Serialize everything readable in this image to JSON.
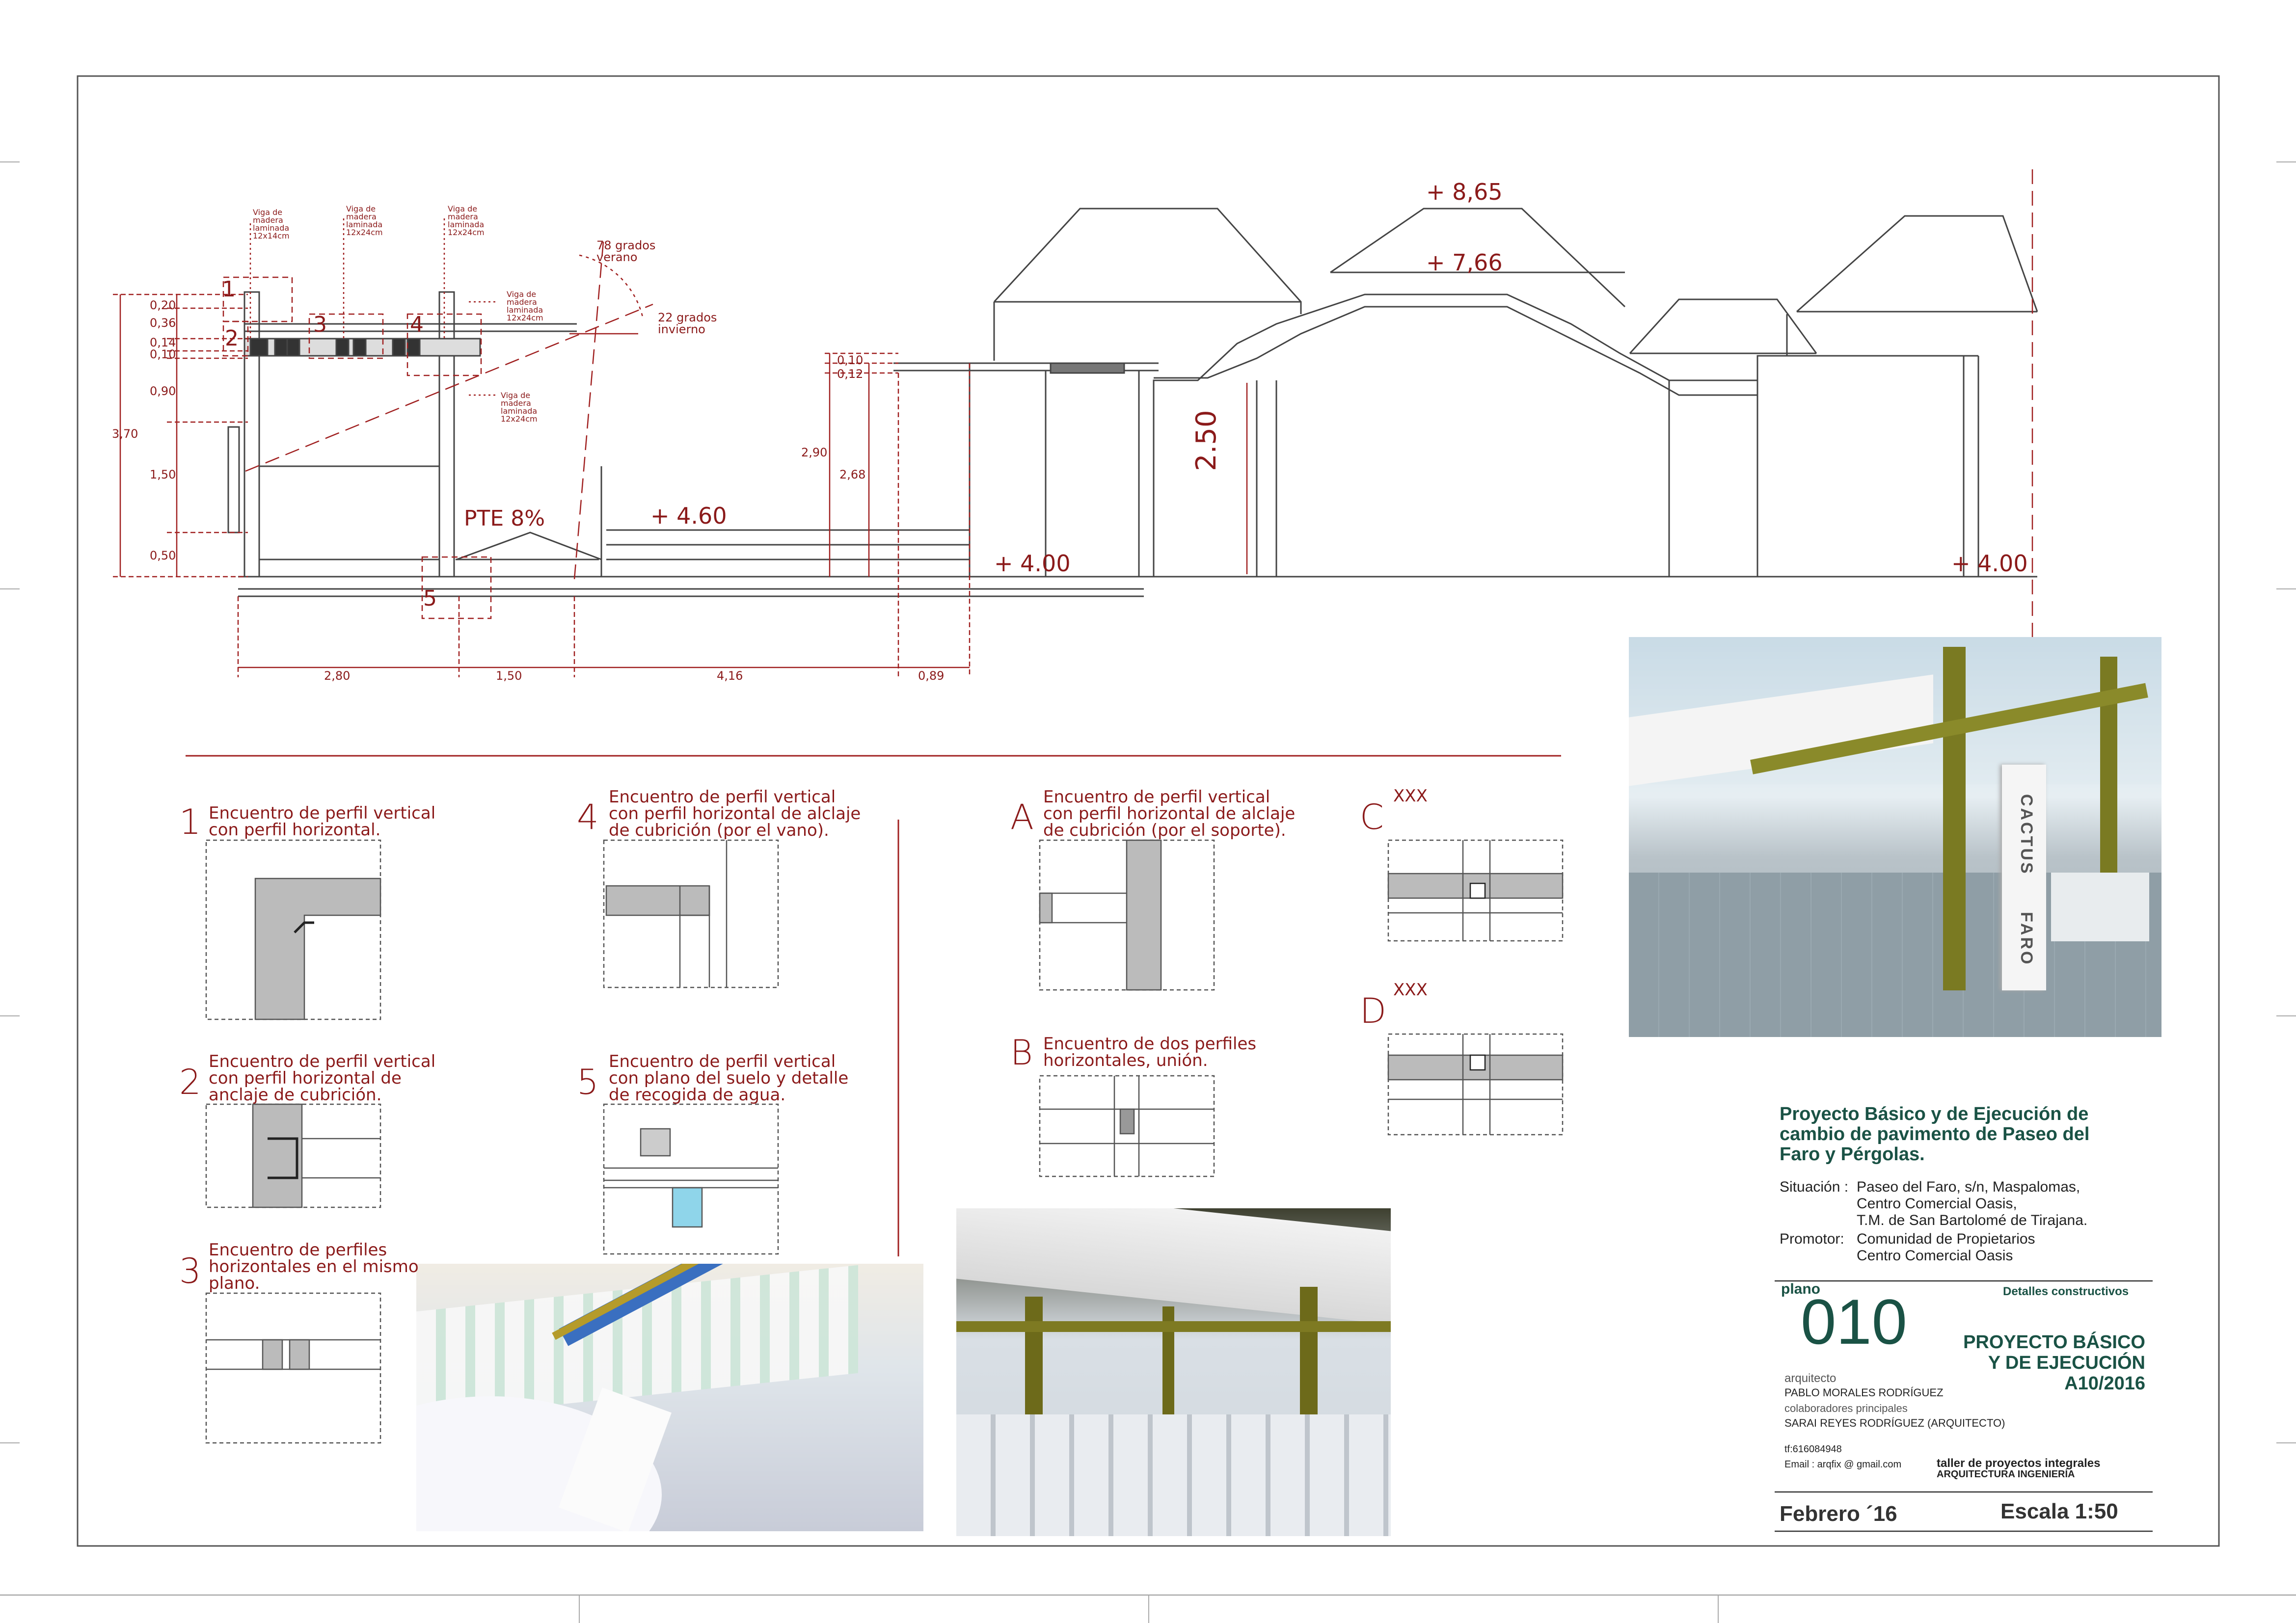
{
  "section": {
    "levels": [
      "+ 8,65",
      "+ 7,66",
      "+ 4.60",
      "+ 4.00",
      "+ 4.00"
    ],
    "slope": "PTE 8%",
    "height_label": "2.50",
    "sun_summer": [
      "78 grados",
      "verano"
    ],
    "sun_winter": [
      "22 grados",
      "invierno"
    ],
    "vertical_dims_left": [
      "0,20",
      "0,36",
      "0,14",
      "0,10",
      "0,90",
      "1,50",
      "0,50"
    ],
    "total_height": "3,70",
    "vertical_dims_right": [
      "0,10",
      "0,12",
      "2,90",
      "2,68"
    ],
    "horizontal_dims": [
      "2,80",
      "1,50",
      "4,16",
      "0,89"
    ],
    "beam_notes": [
      [
        "Viga de",
        "madera",
        "laminada",
        "12x14cm"
      ],
      [
        "Viga de",
        "madera",
        "laminada",
        "12x24cm"
      ],
      [
        "Viga de",
        "madera",
        "laminada",
        "12x24cm"
      ],
      [
        "Viga de",
        "madera",
        "laminada",
        "12x24cm"
      ],
      [
        "Viga de",
        "madera",
        "laminada",
        "12x24cm"
      ]
    ],
    "callouts": [
      "1",
      "2",
      "3",
      "4",
      "5"
    ]
  },
  "details": [
    {
      "id": "1",
      "lines": [
        "Encuentro de perfil vertical",
        "con perfil horizontal."
      ]
    },
    {
      "id": "2",
      "lines": [
        "Encuentro de perfil vertical",
        "con perfil horizontal de",
        "anclaje de cubrición."
      ]
    },
    {
      "id": "3",
      "lines": [
        "Encuentro de perfiles",
        "horizontales en el mismo",
        "plano."
      ]
    },
    {
      "id": "4",
      "lines": [
        "Encuentro de perfil vertical",
        "con perfil horizontal de alclaje",
        "de cubrición (por el vano)."
      ]
    },
    {
      "id": "5",
      "lines": [
        "Encuentro de perfil vertical",
        "con plano del suelo y detalle",
        "de recogida de agua."
      ]
    },
    {
      "id": "A",
      "lines": [
        "Encuentro de perfil vertical",
        "con perfil horizontal de alclaje",
        "de cubrición (por el soporte)."
      ]
    },
    {
      "id": "B",
      "lines": [
        "Encuentro de dos perfiles",
        "horizontales, unión."
      ]
    },
    {
      "id": "C",
      "lines": [
        "XXX"
      ]
    },
    {
      "id": "D",
      "lines": [
        "XXX"
      ]
    }
  ],
  "render_text": {
    "sign_vertical_1": "CACTUS",
    "sign_vertical_2": "FARO"
  },
  "titleblock": {
    "project": [
      "Proyecto Básico y de Ejecución de",
      "cambio de pavimento de Paseo del",
      "Faro y Pérgolas."
    ],
    "situacion_label": "Situación :",
    "situacion": [
      "Paseo del Faro, s/n, Maspalomas,",
      "Centro Comercial Oasis,",
      "T.M. de San Bartolomé de Tirajana."
    ],
    "promotor_label": "Promotor:",
    "promotor": [
      "Comunidad de Propietarios",
      "Centro Comercial Oasis"
    ],
    "plano_label": "plano",
    "plano_number": "010",
    "sheet_title": "Detalles constructivos",
    "phase": [
      "PROYECTO BÁSICO",
      "Y DE EJECUCIÓN"
    ],
    "code": "A10/2016",
    "arquitecto_label": "arquitecto",
    "arquitecto": "PABLO MORALES RODRÍGUEZ",
    "colab_label": "colaboradores   principales",
    "colab": "SARAI REYES RODRÍGUEZ (ARQUITECTO)",
    "phone": "tf:616084948",
    "email": "Email : arqfix @ gmail.com",
    "firm": [
      "taller de proyectos integrales",
      "ARQUITECTURA        INGENIERÍA"
    ],
    "date": "Febrero ´16",
    "scale": "Escala 1:50"
  },
  "colors": {
    "dim": "#a02020",
    "line": "#444444",
    "accent": "#1a5245"
  }
}
